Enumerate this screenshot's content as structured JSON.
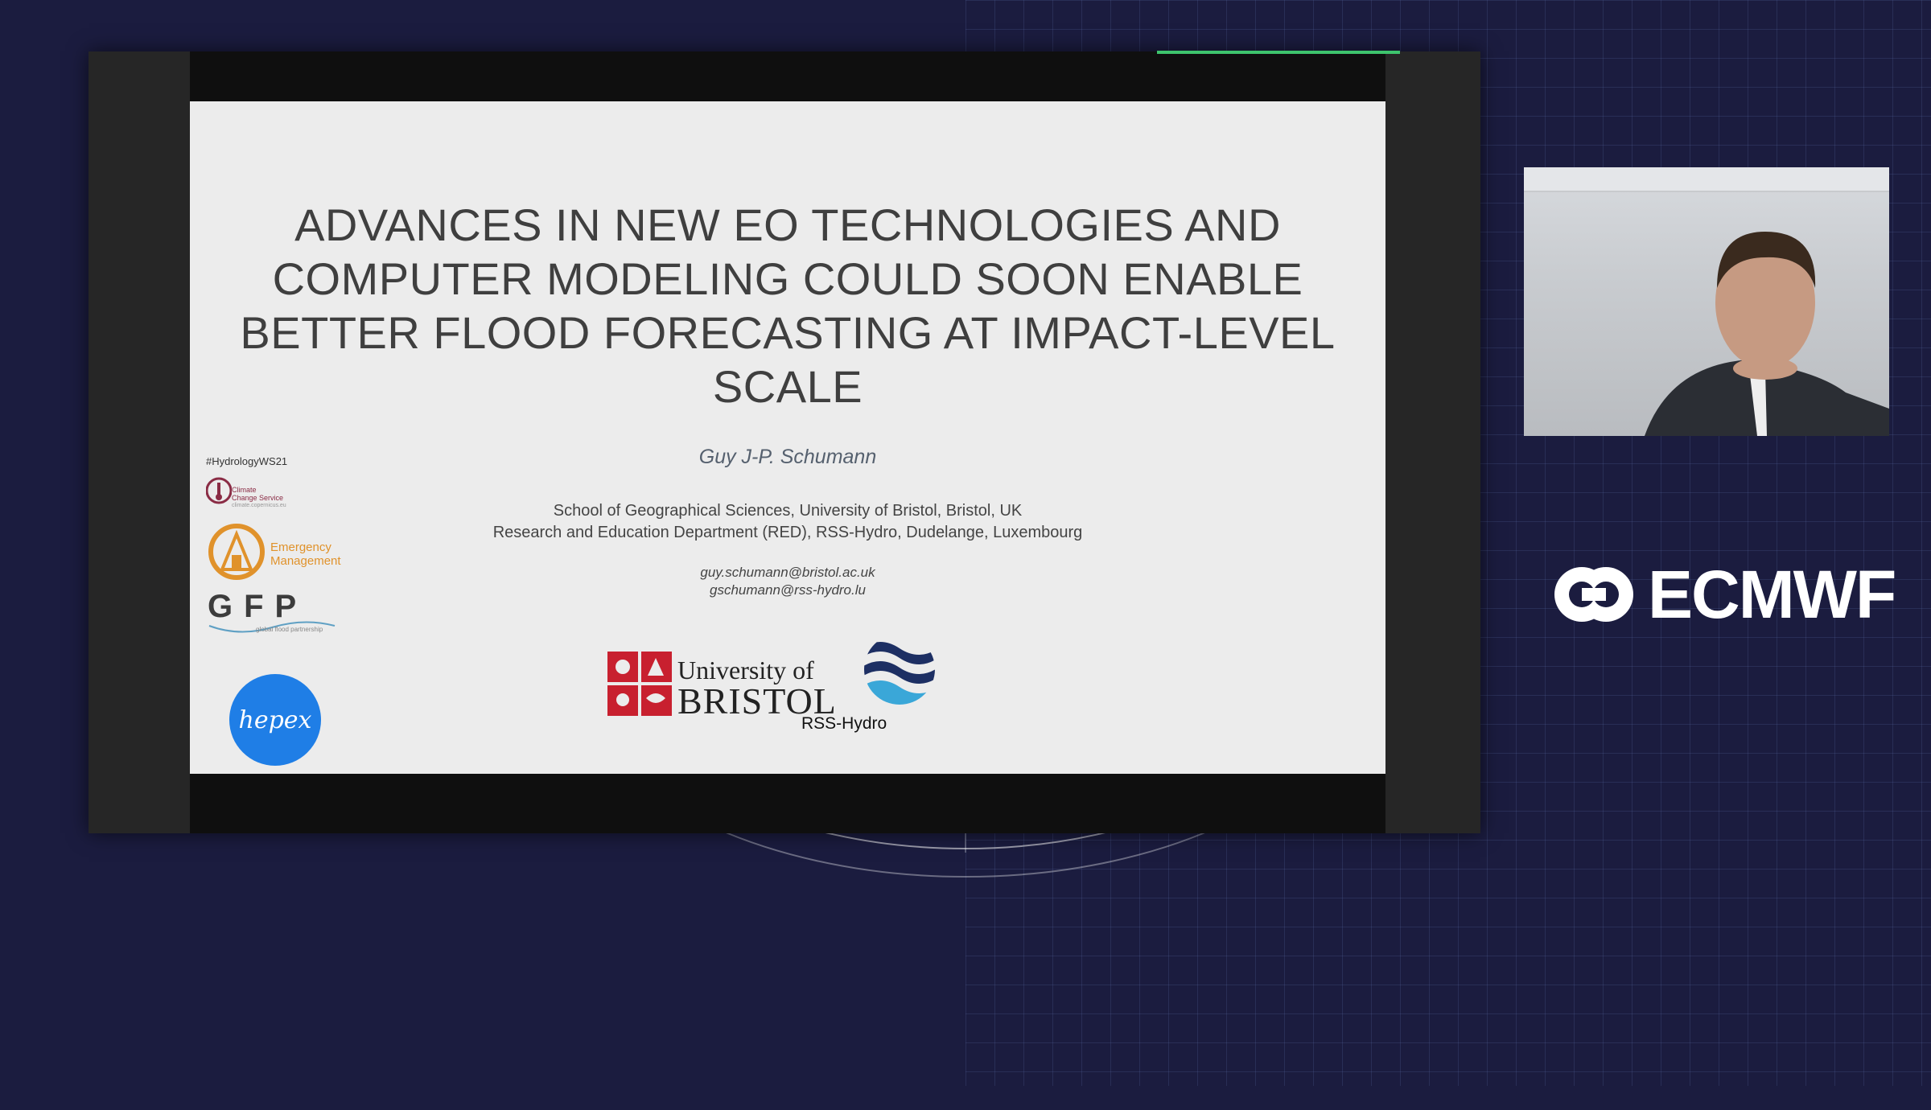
{
  "slide": {
    "title_lines": [
      "ADVANCES IN NEW EO TECHNOLOGIES AND",
      "COMPUTER MODELING COULD SOON ENABLE",
      "BETTER FLOOD FORECASTING AT IMPACT-LEVEL",
      "SCALE"
    ],
    "presenter": "Guy J-P. Schumann",
    "affiliations": [
      "School of Geographical Sciences, University of Bristol, Bristol, UK",
      "Research and Education Department (RED), RSS-Hydro, Dudelange, Luxembourg"
    ],
    "emails": [
      "guy.schumann@bristol.ac.uk",
      "gschumann@rss-hydro.lu"
    ],
    "hashtag": "#HydrologyWS21",
    "side_logos": {
      "c3s_line1": "Climate",
      "c3s_line2": "Change Service",
      "c3s_line3": "climate.copernicus.eu",
      "em_line1": "Emergency",
      "em_line2": "Management",
      "gfp": "GFP",
      "gfp_sub": "global flood partnership",
      "hepex": "hepex"
    },
    "bristol_line1": "University of",
    "bristol_line2": "BRISTOL",
    "rss_label": "RSS-Hydro"
  },
  "brand": {
    "name": "ECMWF"
  },
  "colors": {
    "background": "#1b1c3f",
    "speaking_indicator": "#3ec46d",
    "bristol_red": "#c8202f",
    "hepex_blue": "#1f7ee6"
  }
}
